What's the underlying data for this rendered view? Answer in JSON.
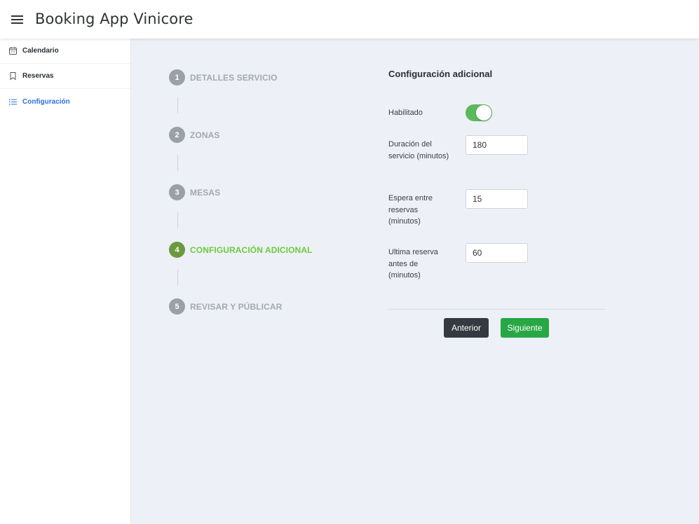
{
  "app": {
    "title": "Booking App Vinicore"
  },
  "sidebar": {
    "items": [
      {
        "label": "Calendario",
        "icon": "calendar-icon"
      },
      {
        "label": "Reservas",
        "icon": "bookmark-icon"
      },
      {
        "label": "Configuración",
        "icon": "list-icon",
        "active": true
      }
    ]
  },
  "stepper": {
    "steps": [
      {
        "number": "1",
        "label": "DETALLES SERVICIO"
      },
      {
        "number": "2",
        "label": "ZONAS"
      },
      {
        "number": "3",
        "label": "MESAS"
      },
      {
        "number": "4",
        "label": "CONFIGURACIÓN ADICIONAL",
        "active": true
      },
      {
        "number": "5",
        "label": "REVISAR Y PÚBLICAR"
      }
    ]
  },
  "form": {
    "title": "Configuración adicional",
    "enabled_label": "Habilitado",
    "enabled_value": true,
    "duration_label": "Duración del servicio (minutos)",
    "duration_value": "180",
    "wait_label": "Espera entre reservas (minutos)",
    "wait_value": "15",
    "last_label": "Ultima reserva antes de (minutos)",
    "last_value": "60"
  },
  "buttons": {
    "prev_label": "Anterior",
    "next_label": "Siguiente"
  },
  "colors": {
    "accent_active": "#2d6fe0",
    "step_active": "#6bcb3b",
    "toggle_on": "#5cb85c",
    "next_button": "#28a745",
    "prev_button": "#343a40",
    "main_bg": "#edf0f7"
  }
}
